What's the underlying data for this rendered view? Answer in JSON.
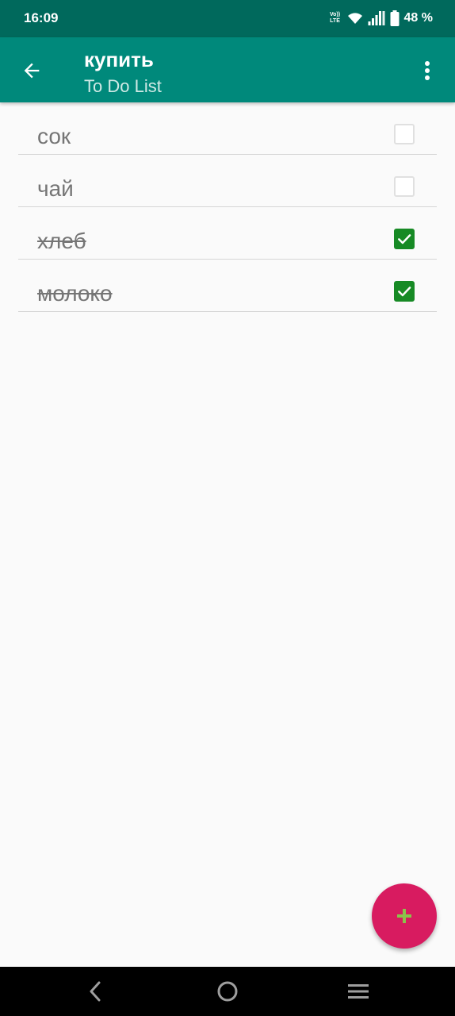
{
  "status_bar": {
    "time": "16:09",
    "volte_top": "Vo))",
    "volte_bottom": "LTE",
    "battery": "48 %",
    "icons": [
      "volte-icon",
      "wifi-icon",
      "signal-icon",
      "battery-icon"
    ]
  },
  "app_bar": {
    "title": "купить",
    "subtitle": "To Do List",
    "back_icon": "arrow-back-icon",
    "menu_icon": "more-vert-icon"
  },
  "items": [
    {
      "label": "сок",
      "checked": false
    },
    {
      "label": "чай",
      "checked": false
    },
    {
      "label": "хлеб",
      "checked": true
    },
    {
      "label": "молоко",
      "checked": true
    }
  ],
  "fab": {
    "icon": "plus-icon",
    "color": "#d81b60",
    "icon_color": "#8bc34a"
  },
  "nav_bar": {
    "icons": [
      "nav-back-icon",
      "nav-home-icon",
      "nav-recents-icon"
    ]
  },
  "colors": {
    "status_bar": "#00695c",
    "app_bar": "#00897b",
    "checkbox_checked": "#178a25",
    "background": "#fafafa"
  }
}
